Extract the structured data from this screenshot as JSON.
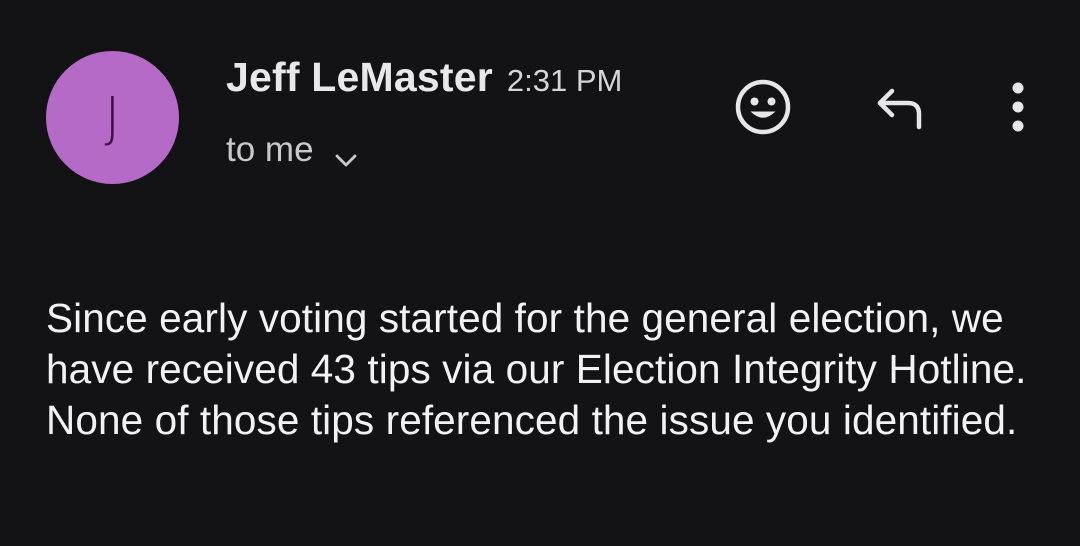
{
  "sender": {
    "avatar_initial": "J",
    "avatar_color": "#b56ac7",
    "name": "Jeff LeMaster",
    "time": "2:31 PM"
  },
  "recipient": {
    "label": "to me",
    "expand_icon": "chevron-down-icon"
  },
  "actions": {
    "react_icon": "smiley-icon",
    "reply_icon": "reply-icon",
    "more_icon": "more-vert-icon"
  },
  "message": {
    "body": "Since early voting started for the general election, we have received 43 tips via our Election Integrity Hotline. None of those tips referenced the issue you identified."
  }
}
